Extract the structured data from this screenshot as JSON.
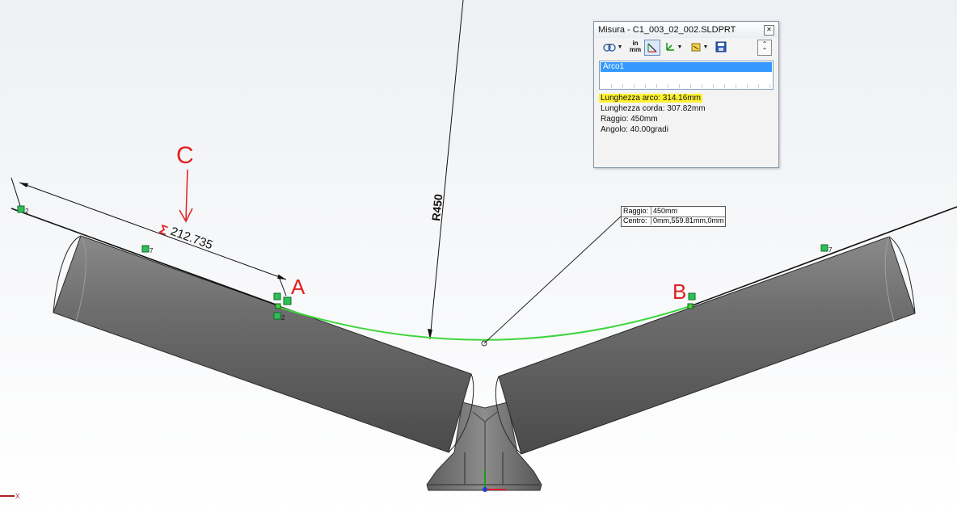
{
  "measure_dialog": {
    "title": "Misura - C1_003_02_002.SLDPRT",
    "close_icon": "close-icon",
    "toolbar": {
      "arc_options_icon": "arc-circle-options-icon",
      "units_label_top": "in",
      "units_label_bottom": "mm",
      "xyz_icon": "xyz-projection-icon",
      "coordinate_icon": "coordinate-system-icon",
      "history_icon": "measure-history-icon",
      "save_icon": "save-icon",
      "collapse_icon": "chevron-up-icon"
    },
    "selection": "Arco1",
    "results": {
      "arc_length": "Lunghezza arco: 314.16mm",
      "chord_length": "Lunghezza corda: 307.82mm",
      "radius": "Raggio: 450mm",
      "angle": "Angolo: 40.00gradi"
    },
    "highlight_color": "#fff231"
  },
  "radius_tooltip": {
    "radius_label": "Raggio:",
    "radius_value": "450mm",
    "center_label": "Centro:",
    "center_value": "0mm,559.81mm,0mm"
  },
  "drawing": {
    "radius_dimension": "R450",
    "length_dimension": "212.735",
    "sum_symbol": "Σ",
    "handwritten_c": "C",
    "point_a": "A",
    "point_b": "B",
    "relation_counts": [
      "2",
      "7",
      "2",
      "7"
    ],
    "triad_x": "X",
    "arc_color": "#3cd63c",
    "annotation_color": "#e02020"
  }
}
